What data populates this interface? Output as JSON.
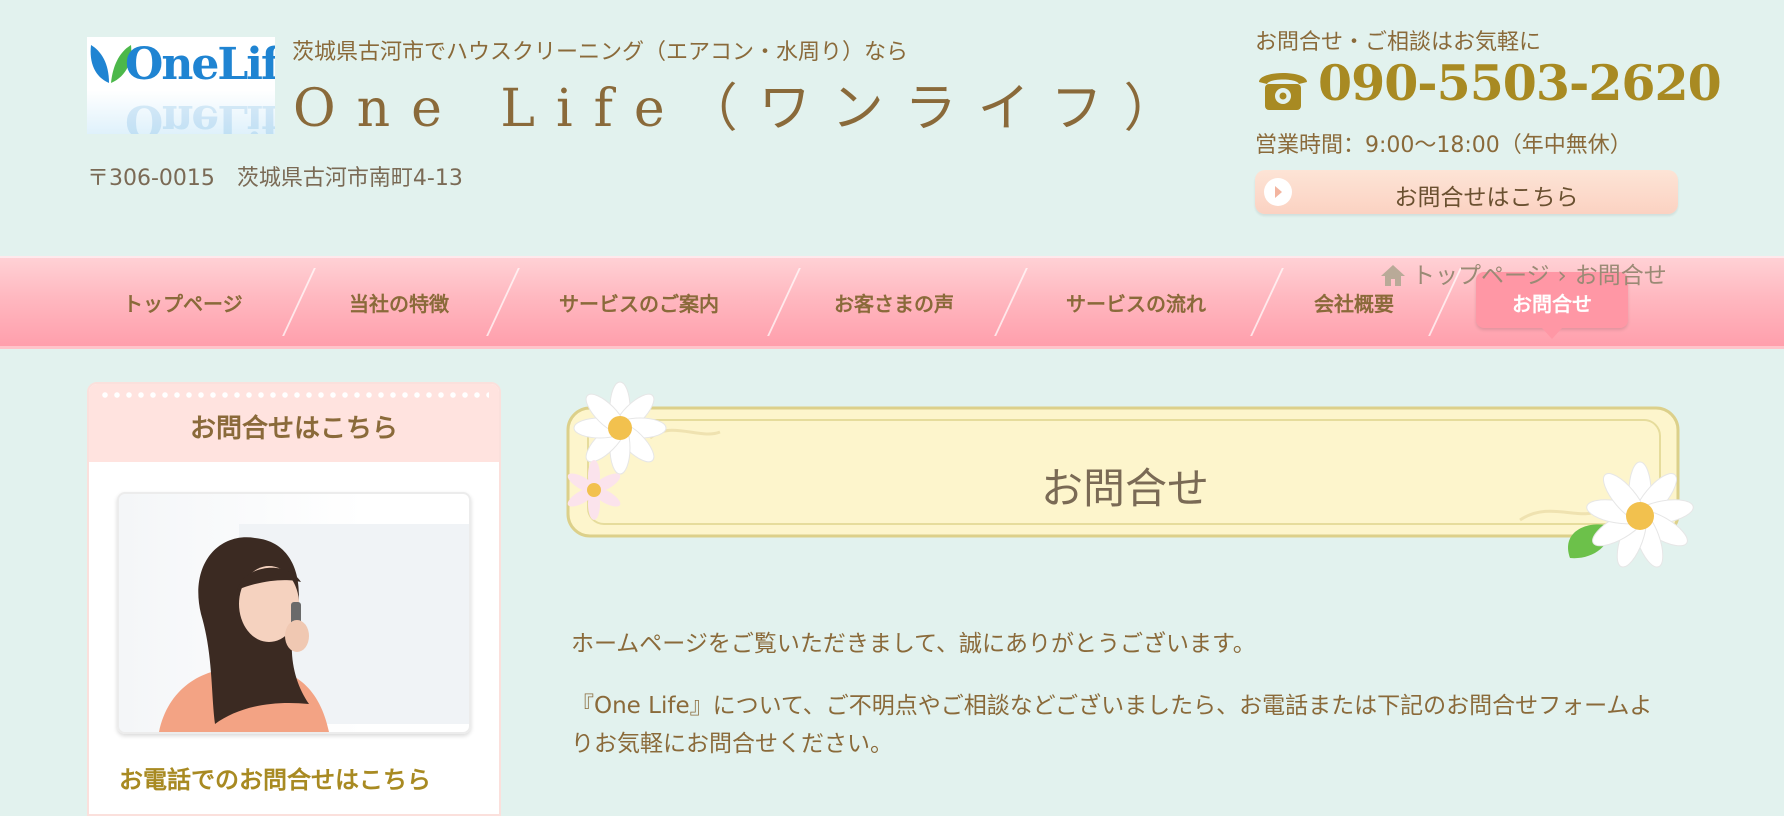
{
  "header": {
    "logo_text": "OneLife",
    "tagline": "茨城県古河市でハウスクリーニング（エアコン・水周り）なら",
    "site_name": "One Life（ワンライフ）",
    "address": "〒306-0015　茨城県古河市南町4-13",
    "contact": {
      "lead": "お問合せ・ご相談はお気軽に",
      "phone": "090-5503-2620",
      "hours": "営業時間：9:00～18:00（年中無休）",
      "button_label": "お問合せはこちら"
    }
  },
  "nav": {
    "items": [
      "トップページ",
      "当社の特徴",
      "サービスのご案内",
      "お客さまの声",
      "サービスの流れ",
      "会社概要",
      "お問合せ"
    ],
    "active_index": 6
  },
  "breadcrumb": {
    "home": "トップページ",
    "separator": "›",
    "current": "お問合せ"
  },
  "sidebar": {
    "title": "お問合せはこちら",
    "subtitle": "お電話でのお問合せはこちら"
  },
  "main": {
    "heading": "お問合せ",
    "intro": [
      "ホームページをご覧いただきまして、誠にありがとうございます。",
      "『One Life』について、ご不明点やご相談などございましたら、お電話または下記のお問合せフォームよりお気軽にお問合せください。"
    ]
  },
  "colors": {
    "background": "#e2f2ee",
    "text_brown": "#8a6a3a",
    "phone_gold": "#a88a22",
    "nav_pink": "#ffb8c0",
    "active_pink": "#ff97a5",
    "banner_cream": "#fdf5cc",
    "logo_blue": "#1f84d2"
  },
  "icons": [
    "leaf-logo-icon",
    "telephone-icon",
    "arrow-circle-icon",
    "home-icon",
    "daisy-flower-icon"
  ]
}
